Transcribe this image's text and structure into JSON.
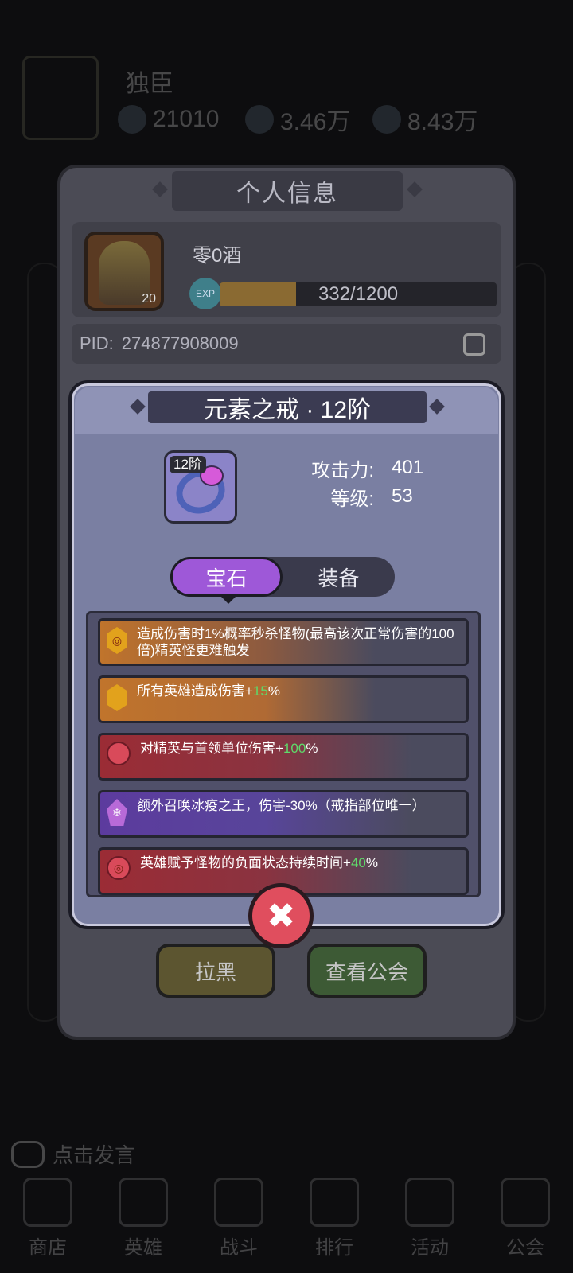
{
  "background": {
    "player_name": "独臣",
    "stats": [
      "21010",
      "3.46万",
      "8.43万"
    ],
    "chat_placeholder": "点击发言",
    "nav_items": [
      "商店",
      "英雄",
      "战斗",
      "排行",
      "活动",
      "公会"
    ]
  },
  "profile": {
    "title": "个人信息",
    "name": "零0酒",
    "level": "20",
    "exp_label": "EXP",
    "exp_text": "332/1200",
    "exp_fraction": 0.277,
    "pid_label": "PID:",
    "pid_value": "274877908009",
    "buttons": {
      "blacklist": "拉黑",
      "view_guild": "查看公会"
    }
  },
  "item": {
    "title": "元素之戒 · 12阶",
    "tier_badge": "12阶",
    "stats": [
      {
        "label": "攻击力:",
        "value": "401"
      },
      {
        "label": "等级:",
        "value": "53"
      }
    ],
    "tabs": {
      "gem": "宝石",
      "equip": "装备"
    },
    "active_tab": "gem",
    "effects": [
      {
        "icon": "gold-spiral-hex-gem-icon",
        "text": "造成伤害时1%概率秒杀怪物(最高该次正常伤害的100倍)精英怪更难触发"
      },
      {
        "icon": "gold-hex-gem-icon",
        "prefix": "所有英雄造成伤害+",
        "highlight": "15",
        "suffix": "%"
      },
      {
        "icon": "red-round-gem-icon",
        "prefix": "对精英与首领单位伤害+",
        "highlight": "100",
        "suffix": "%"
      },
      {
        "icon": "purple-snowflake-gem-icon",
        "text": "额外召唤冰疫之王，伤害-30%（戒指部位唯一）"
      },
      {
        "icon": "red-spiral-gem-icon",
        "prefix": "英雄赋予怪物的负面状态持续时间+",
        "highlight": "40",
        "suffix": "%"
      }
    ],
    "close_label": "✖"
  },
  "colors": {
    "modal_bg": "#7a7fa2",
    "tab_active": "#9e58d8",
    "highlight_green": "#5fd96a",
    "close_red": "#e04e5e"
  }
}
